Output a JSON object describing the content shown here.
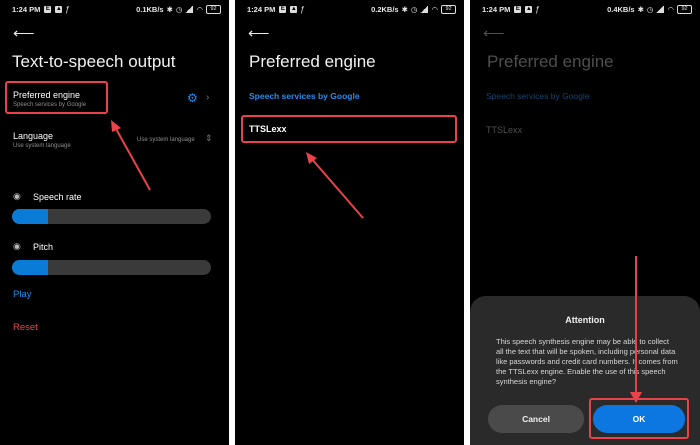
{
  "screens": [
    {
      "status": {
        "time": "1:24 PM",
        "speed": "0.1KB/s",
        "battery": "92"
      },
      "title": "Text-to-speech output",
      "preferred_engine": {
        "label": "Preferred engine",
        "sub": "Speech services by Google"
      },
      "language": {
        "label": "Language",
        "sub": "Use system language",
        "value": "Use system language"
      },
      "speech_rate": {
        "label": "Speech rate",
        "level": 0.18
      },
      "pitch": {
        "label": "Pitch",
        "level": 0.18
      },
      "play": "Play",
      "reset": "Reset"
    },
    {
      "status": {
        "time": "1:24 PM",
        "speed": "0.2KB/s",
        "battery": "92"
      },
      "title": "Preferred engine",
      "options": [
        "Speech services by Google",
        "TTSLexx"
      ]
    },
    {
      "status": {
        "time": "1:24 PM",
        "speed": "0.4KB/s",
        "battery": "92"
      },
      "title": "Preferred engine",
      "options": [
        "Speech services by Google",
        "TTSLexx"
      ],
      "dialog": {
        "title": "Attention",
        "body": "This speech synthesis engine may be able to collect all the text that will be spoken, including personal data like passwords and credit card numbers. It comes from the TTSLexx engine. Enable the use of this speech synthesis engine?",
        "cancel": "Cancel",
        "ok": "OK"
      }
    }
  ],
  "colors": {
    "accent": "#1e8ff2",
    "annotation": "#e8434a",
    "reset": "#e6484c"
  }
}
